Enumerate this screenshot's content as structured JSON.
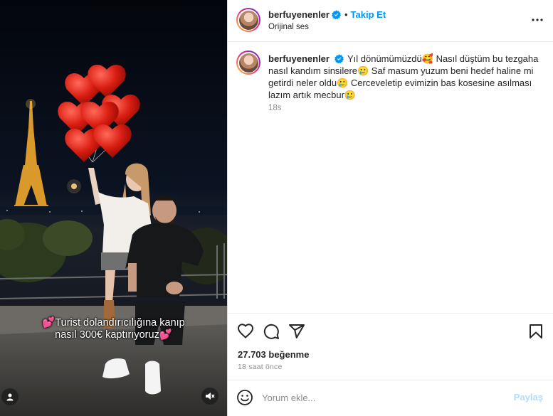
{
  "post": {
    "username": "berfuyenenler",
    "follow_label": "Takip Et",
    "separator": "•",
    "audio": "Orijinal ses",
    "caption_text": "Yıl dönümümüzdü🥰 Nasıl düştüm bu tezgaha nasıl kandım sinsilere🥲 Saf masum yuzum beni hedef haline mi getirdi neler oldu🥲 Cerceveletip evimizin bas kosesine asılması lazım artık mecbur🥲",
    "caption_time": "18s",
    "likes": "27.703 beğenme",
    "posted_ago": "18 saat önce"
  },
  "media": {
    "overlay_line1": "💕Turist dolandırıcılığına kanıp",
    "overlay_line2": "nasıl 300€ kaptırıyoruz💕"
  },
  "comment_box": {
    "placeholder": "Yorum ekle...",
    "post_label": "Paylaş"
  },
  "icons": {
    "verified": "verified-badge-icon",
    "more": "more-options-icon",
    "like": "heart-icon",
    "comment": "comment-bubble-icon",
    "share": "paper-plane-icon",
    "save": "bookmark-icon",
    "emoji": "smiley-icon",
    "tag": "user-tag-icon",
    "mute": "speaker-muted-icon"
  },
  "colors": {
    "accent": "#0095f6",
    "post_disabled": "#b3dbff",
    "verified": "#0095f6",
    "muted_text": "#8e8e8e"
  }
}
